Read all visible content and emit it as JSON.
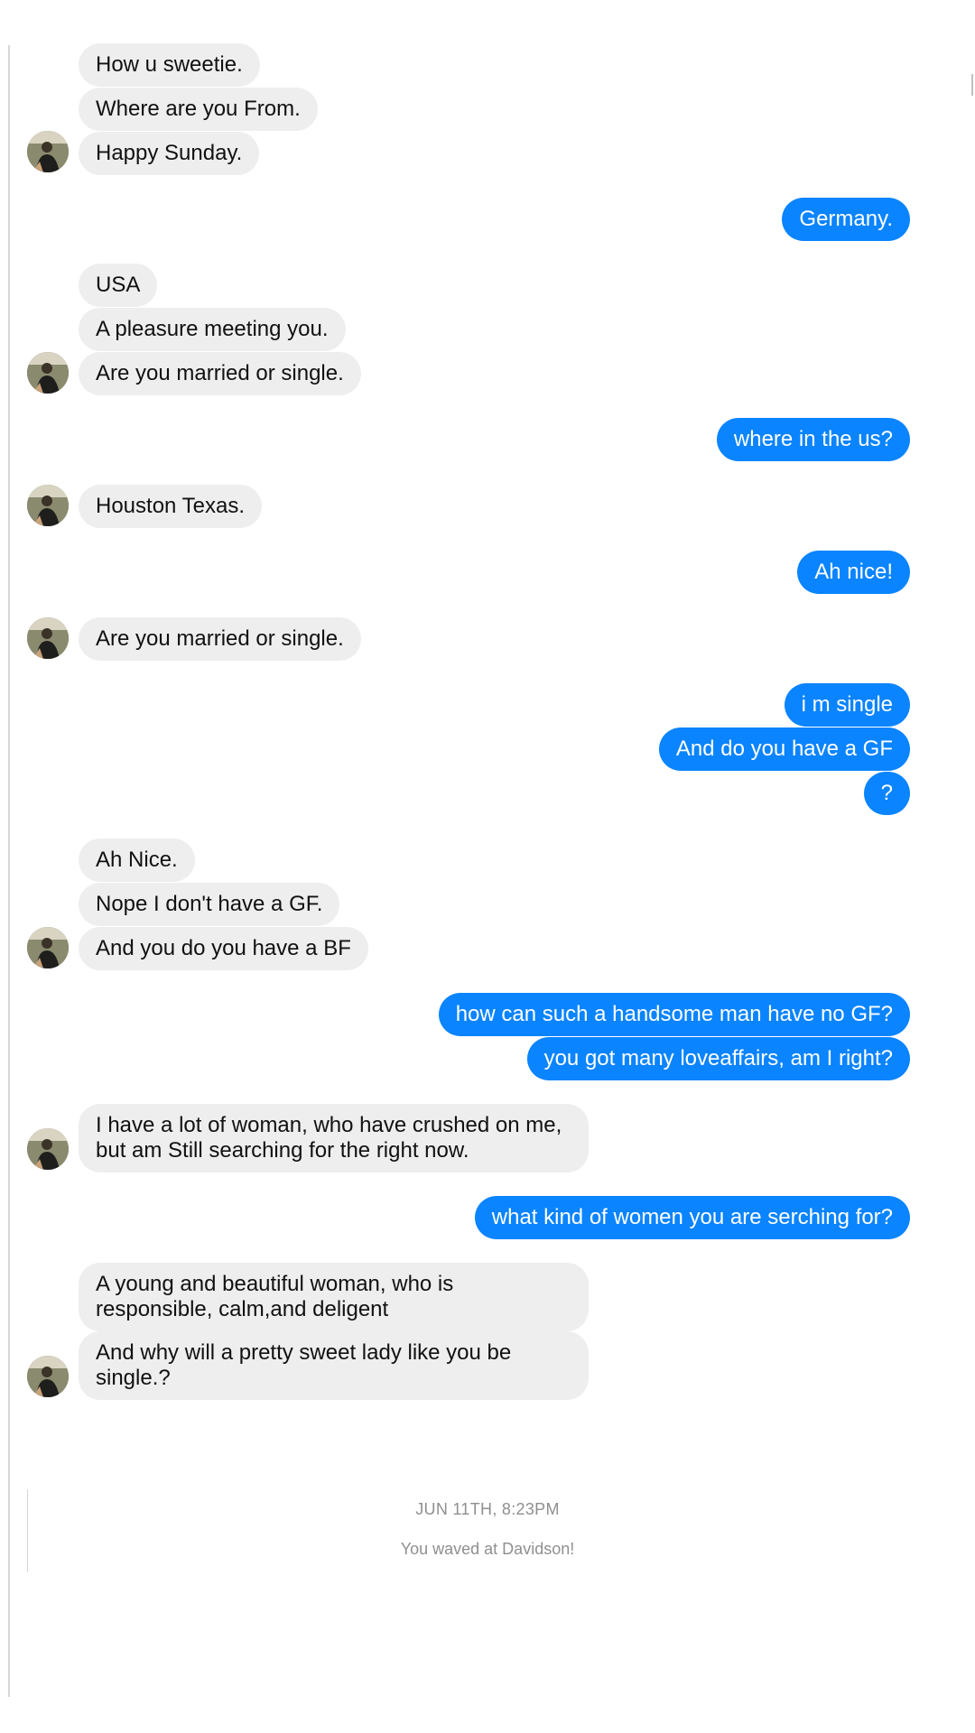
{
  "messages": {
    "m1": "How u sweetie.",
    "m2": "Where are you From.",
    "m3": "Happy Sunday.",
    "m4": "Germany.",
    "m5": "USA",
    "m6": "A pleasure meeting you.",
    "m7": "Are you married or single.",
    "m8": "where in the us?",
    "m9": "Houston Texas.",
    "m10": "Ah nice!",
    "m11": "Are you married or single.",
    "m12": "i m single",
    "m13": "And do you have a GF",
    "m14": "?",
    "m15": "Ah Nice.",
    "m16": "Nope I don't have a GF.",
    "m17": "And you do you have a BF",
    "m18": "how can such a handsome man have no GF?",
    "m19": "you got many loveaffairs, am I right?",
    "m20": "I have a lot of woman, who have crushed on me, but am Still searching for the right now.",
    "m21": "what kind of women you are serching for?",
    "m22": "A young and beautiful woman, who is responsible, calm,and deligent",
    "m23": "And why will a pretty sweet lady like you be single.?"
  },
  "footer": {
    "date": "JUN 11TH, 8:23PM",
    "wave": "You waved at Davidson!"
  },
  "colors": {
    "incoming_bubble": "#efeeef",
    "outgoing_bubble": "#0a84ff",
    "meta_text": "#8f8f8f"
  },
  "icons": {
    "avatar": "contact-avatar"
  }
}
